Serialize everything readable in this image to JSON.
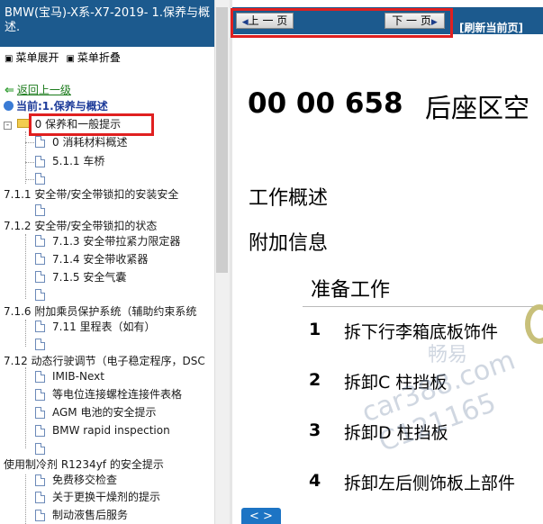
{
  "sidebar": {
    "title": "BMW(宝马)-X系-X7-2019- 1.保养与概述.",
    "menu": {
      "expand": "菜单展开",
      "collapse": "菜单折叠",
      "square": "▣"
    },
    "back": "返回上一级",
    "current": "当前:1.保养与概述",
    "tree": [
      {
        "label": "0 保养和一般提示"
      },
      {
        "label": "0 消耗材料概述"
      },
      {
        "label": "5.1.1 车桥"
      },
      {
        "label": "7.1.1 安全带/安全带锁扣的安装安全"
      },
      {
        "label": "7.1.2 安全带/安全带锁扣的状态"
      },
      {
        "label": "7.1.3 安全带拉紧力限定器"
      },
      {
        "label": "7.1.4 安全带收紧器"
      },
      {
        "label": "7.1.5 安全气囊"
      },
      {
        "label": "7.1.6 附加乘员保护系统（辅助约束系统"
      },
      {
        "label": "7.11 里程表（如有）"
      },
      {
        "label": "7.12 动态行驶调节（电子稳定程序，DSC"
      },
      {
        "label": "IMIB-Next"
      },
      {
        "label": "等电位连接螺栓连接件表格"
      },
      {
        "label": "AGM 电池的安全提示"
      },
      {
        "label": "BMW rapid inspection"
      },
      {
        "label": "使用制冷剂 R1234yf 的安全提示"
      },
      {
        "label": "免费移交检查"
      },
      {
        "label": "关于更换干燥剂的提示"
      },
      {
        "label": "制动液售后服务"
      }
    ]
  },
  "toolbar": {
    "prev": "上 一 页",
    "next": "下 一 页",
    "refresh": "[刷新当前页]"
  },
  "document": {
    "code": "00 00 658",
    "title_cn": "后座区空",
    "section_overview": "工作概述",
    "section_info": "附加信息",
    "prep_title": "准备工作",
    "steps": [
      {
        "num": "1",
        "text": "拆下行李箱底板饰件"
      },
      {
        "num": "2",
        "text": "拆卸C 柱挡板"
      },
      {
        "num": "3",
        "text": "拆卸D 柱挡板"
      },
      {
        "num": "4",
        "text": "拆卸左后侧饰板上部件"
      }
    ],
    "bottom_button": "< >"
  },
  "watermark": {
    "line1": "畅易",
    "line2": "car388.com",
    "line3": "C121165"
  },
  "colors": {
    "header": "#1c5a8e",
    "highlight": "#e02020",
    "current": "#1e3c9a",
    "back": "#1a7a1a"
  }
}
